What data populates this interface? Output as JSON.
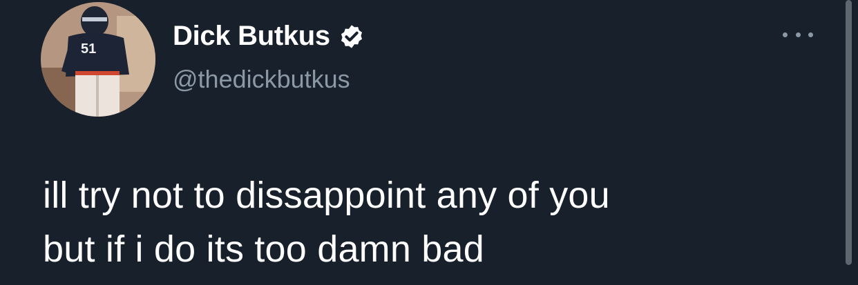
{
  "author": {
    "display_name": "Dick Butkus",
    "handle": "@thedickbutkus",
    "verified": true,
    "avatar_jersey_number": "51"
  },
  "tweet": {
    "text": "ill try not to dissappoint any of you\nbut if i do its too damn bad"
  },
  "icons": {
    "more": "more-horizontal-icon",
    "verified": "verified-badge-icon"
  },
  "colors": {
    "background": "#17202b",
    "text_primary": "#ffffff",
    "text_secondary": "#8b98a5"
  }
}
